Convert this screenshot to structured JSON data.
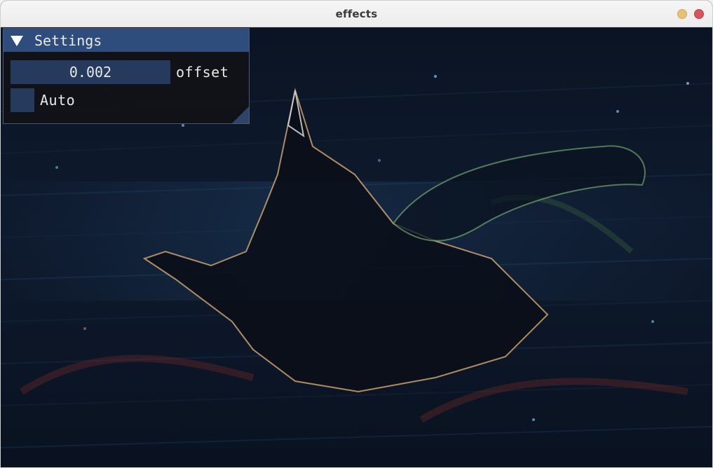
{
  "window": {
    "title": "effects",
    "controls": [
      "minimize",
      "close"
    ]
  },
  "panel": {
    "header": {
      "title": "Settings",
      "collapse_icon": "triangle-down-icon"
    },
    "offset": {
      "value": "0.002",
      "label": "offset"
    },
    "auto": {
      "label": "Auto",
      "checked": false
    }
  },
  "canvas": {
    "content": "image-preview"
  },
  "colors": {
    "header": "#2e4d7c",
    "input": "#253a5c",
    "panel_bg": "#121216",
    "titlebar": "#efefef",
    "minimize": "#e7c07a",
    "close": "#d4565e"
  }
}
